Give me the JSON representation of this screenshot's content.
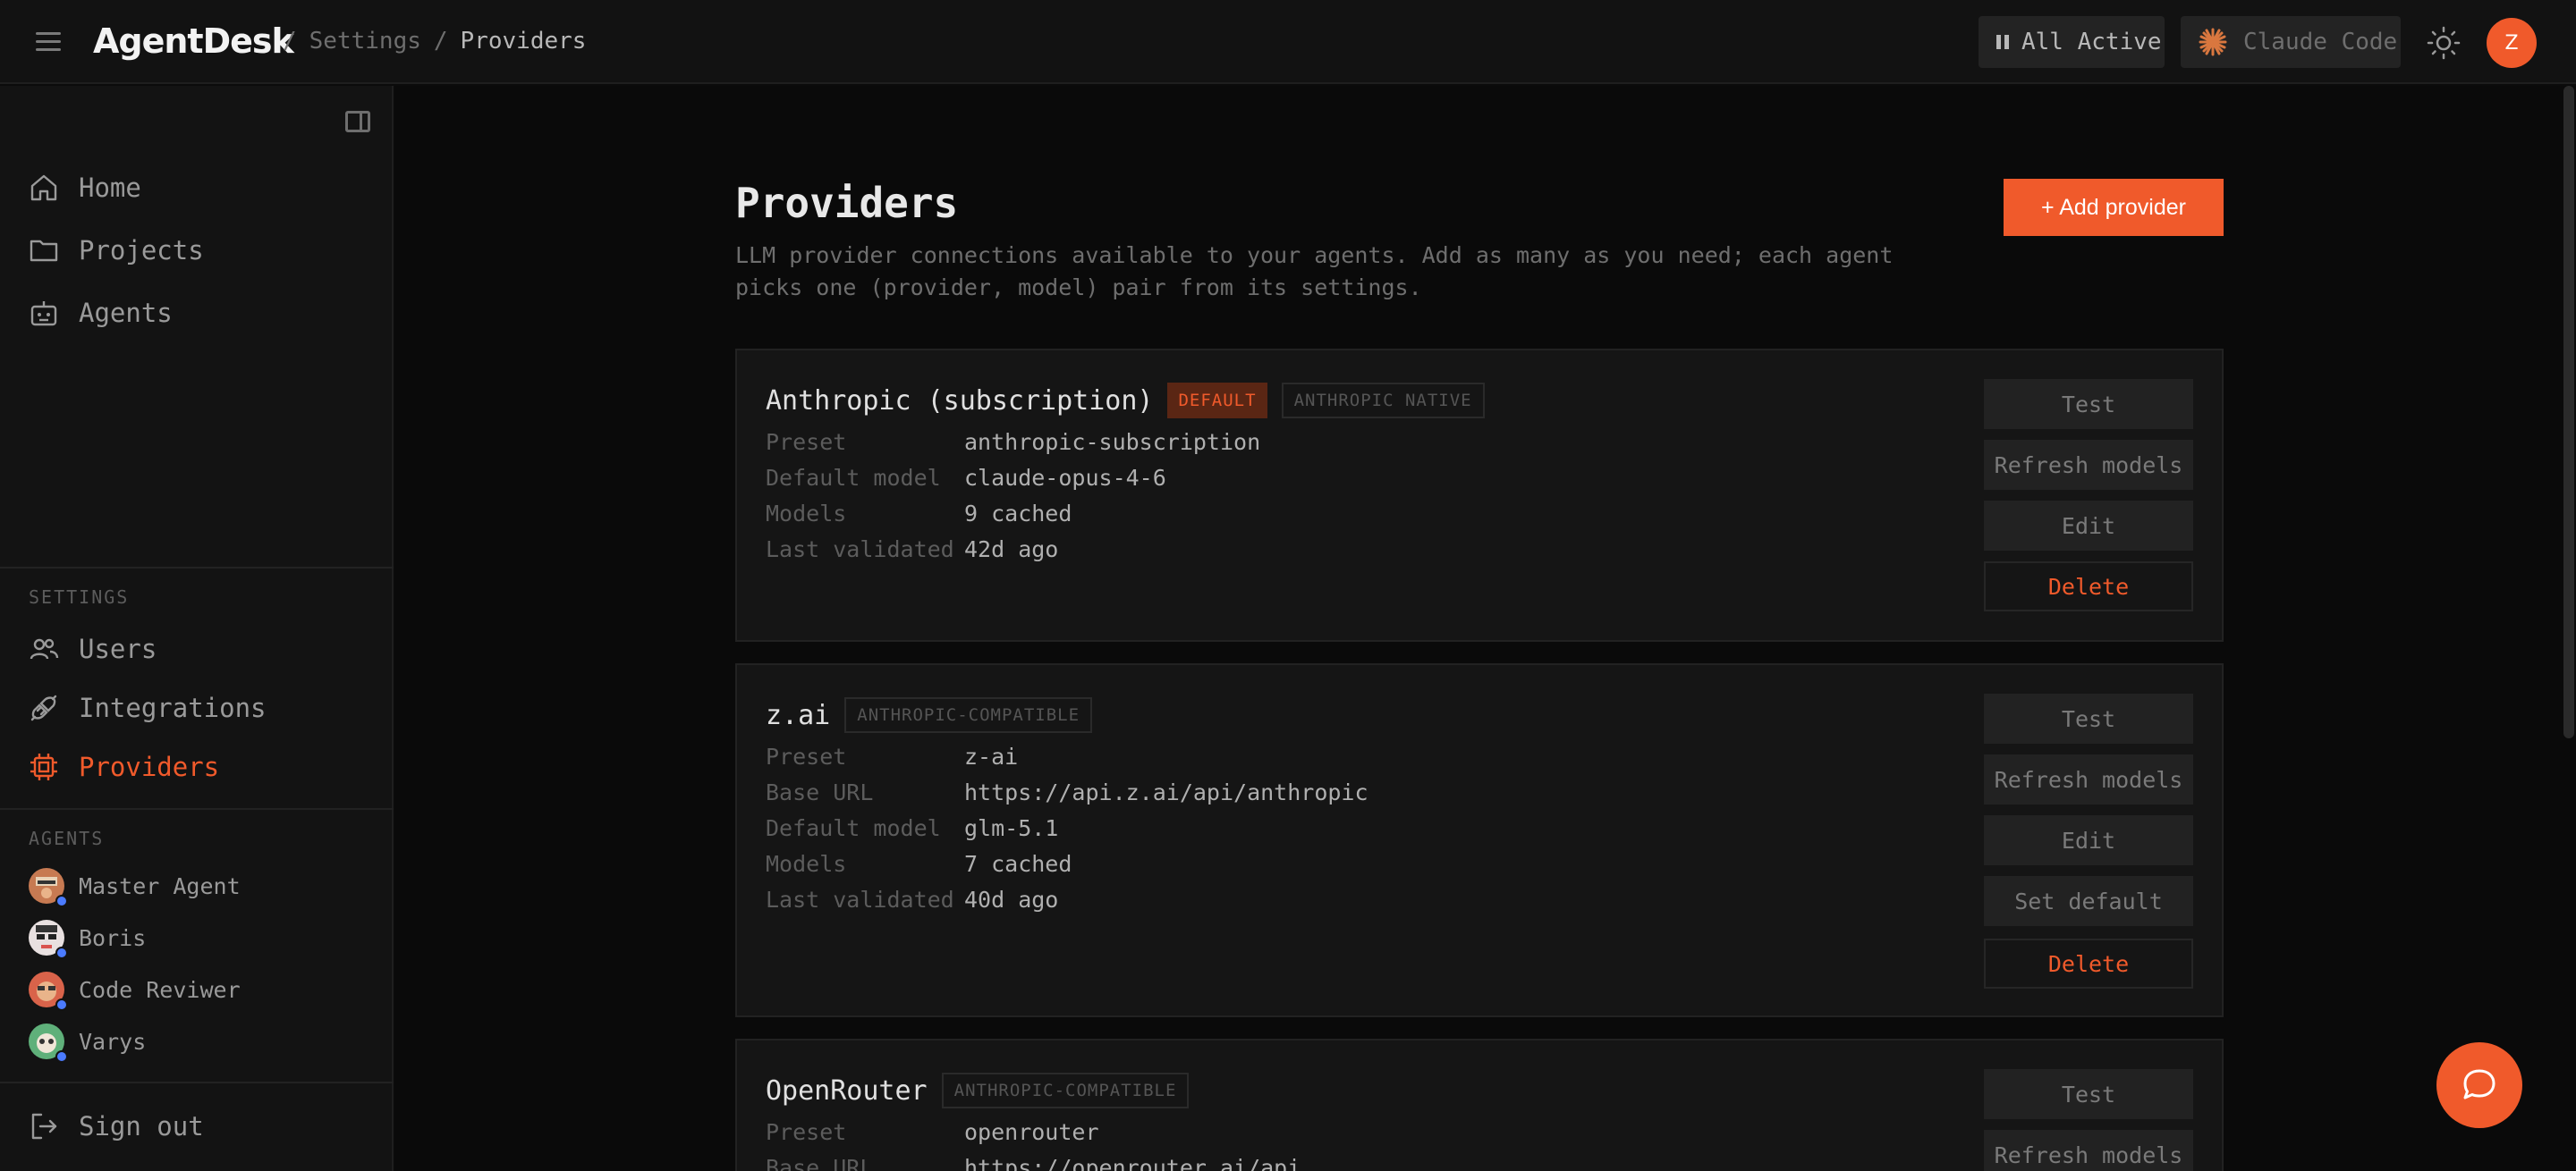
{
  "app": {
    "brand": "AgentDesk"
  },
  "breadcrumb": {
    "sep1": "/",
    "settings": "Settings",
    "sep2": "/",
    "current": "Providers"
  },
  "header": {
    "status_label": "All Active",
    "runtime_label": "Claude Code",
    "user_initial": "Z"
  },
  "sidebar": {
    "nav": [
      {
        "label": "Home"
      },
      {
        "label": "Projects"
      },
      {
        "label": "Agents"
      }
    ],
    "settings_label": "SETTINGS",
    "settings_items": [
      {
        "label": "Users"
      },
      {
        "label": "Integrations"
      },
      {
        "label": "Providers"
      }
    ],
    "agents_label": "AGENTS",
    "agents": [
      {
        "name": "Master Agent"
      },
      {
        "name": "Boris"
      },
      {
        "name": "Code Reviwer"
      },
      {
        "name": "Varys"
      }
    ],
    "signout": "Sign out"
  },
  "page": {
    "title": "Providers",
    "description": "LLM provider connections available to your agents. Add as many as you need; each agent picks one (provider, model) pair from its settings.",
    "add_button": "+ Add provider"
  },
  "providers": [
    {
      "name": "Anthropic (subscription)",
      "default_badge": "DEFAULT",
      "type_badge": "ANTHROPIC NATIVE",
      "fields": [
        {
          "key": "Preset",
          "value": "anthropic-subscription"
        },
        {
          "key": "Default model",
          "value": "claude-opus-4-6"
        },
        {
          "key": "Models",
          "value": "9 cached"
        },
        {
          "key": "Last validated",
          "value": "42d ago"
        }
      ],
      "actions": {
        "test": "Test",
        "refresh": "Refresh models",
        "edit": "Edit",
        "delete": "Delete"
      }
    },
    {
      "name": "z.ai",
      "type_badge": "ANTHROPIC-COMPATIBLE",
      "fields": [
        {
          "key": "Preset",
          "value": "z-ai"
        },
        {
          "key": "Base URL",
          "value": "https://api.z.ai/api/anthropic"
        },
        {
          "key": "Default model",
          "value": "glm-5.1"
        },
        {
          "key": "Models",
          "value": "7 cached"
        },
        {
          "key": "Last validated",
          "value": "40d ago"
        }
      ],
      "actions": {
        "test": "Test",
        "refresh": "Refresh models",
        "edit": "Edit",
        "set_default": "Set default",
        "delete": "Delete"
      }
    },
    {
      "name": "OpenRouter",
      "type_badge": "ANTHROPIC-COMPATIBLE",
      "fields": [
        {
          "key": "Preset",
          "value": "openrouter"
        },
        {
          "key": "Base URL",
          "value": "https://openrouter.ai/api"
        }
      ],
      "actions": {
        "test": "Test",
        "refresh": "Refresh models"
      }
    }
  ],
  "colors": {
    "accent": "#f05a2b",
    "background": "#0a0a0a",
    "panel": "#151515"
  },
  "icons": [
    "menu-icon",
    "pause-icon",
    "claude-icon",
    "sun-icon",
    "sidebar-collapse-icon",
    "home-icon",
    "folder-icon",
    "robot-icon",
    "users-icon",
    "plug-icon",
    "chip-icon",
    "sign-out-icon",
    "chat-icon"
  ]
}
